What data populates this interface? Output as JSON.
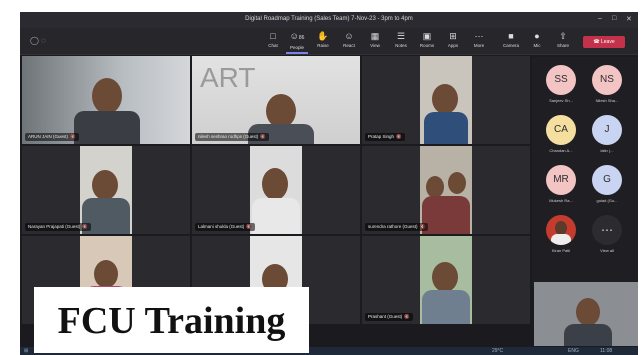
{
  "window": {
    "title": "Digital Roadmap Training (Sales Team) 7-Nov-23 - 3pm to 4pm"
  },
  "toolbar": {
    "buttons": [
      {
        "label": "Chat",
        "icon": "chat-icon"
      },
      {
        "label": "People",
        "icon": "people-icon",
        "count": "86"
      },
      {
        "label": "Raise",
        "icon": "raise-hand-icon"
      },
      {
        "label": "React",
        "icon": "react-icon"
      },
      {
        "label": "View",
        "icon": "view-icon"
      },
      {
        "label": "Notes",
        "icon": "notes-icon"
      },
      {
        "label": "Rooms",
        "icon": "rooms-icon"
      },
      {
        "label": "Apps",
        "icon": "apps-icon"
      },
      {
        "label": "More",
        "icon": "more-icon"
      },
      {
        "label": "Camera",
        "icon": "camera-icon"
      },
      {
        "label": "Mic",
        "icon": "mic-icon"
      },
      {
        "label": "Share",
        "icon": "share-icon"
      }
    ],
    "leave_label": "Leave"
  },
  "participants_grid": [
    {
      "name": "ARUN JAIN (Guest)"
    },
    {
      "name": "nilesh seshrao rodhps (Guest)"
    },
    {
      "name": "Pratap Singh"
    },
    {
      "name": "Narayan Prajapati (Guest)"
    },
    {
      "name": "Lalmani shukla (Guest)"
    },
    {
      "name": "surendra rathore (Guest)"
    },
    {
      "name": ""
    },
    {
      "name": ""
    },
    {
      "name": "Prashant (Guest)"
    }
  ],
  "side_panel": {
    "avatars": [
      {
        "initials": "SS",
        "name": "Sanjeev Sh...",
        "color": "#f2c4c4"
      },
      {
        "initials": "NS",
        "name": "Nilesh Sha...",
        "color": "#f2c4c4"
      },
      {
        "initials": "CA",
        "name": "Chandan A...",
        "color": "#f5dfa0"
      },
      {
        "initials": "J",
        "name": "iatin (...",
        "color": "#c9d4f2"
      },
      {
        "initials": "MR",
        "name": "Mukesh Ra...",
        "color": "#f2c4c4"
      },
      {
        "initials": "G",
        "name": "gulad (Gu...",
        "color": "#c9d4f2"
      },
      {
        "initials": "",
        "name": "Kiran Patil",
        "color": "#c53b2e"
      }
    ],
    "view_all_label": "View all"
  },
  "taskbar": {
    "search_label": "Type here to search",
    "temperature": "29°C",
    "language": "ENG",
    "time": "11:08"
  },
  "overlay": {
    "caption": "FCU Training"
  }
}
